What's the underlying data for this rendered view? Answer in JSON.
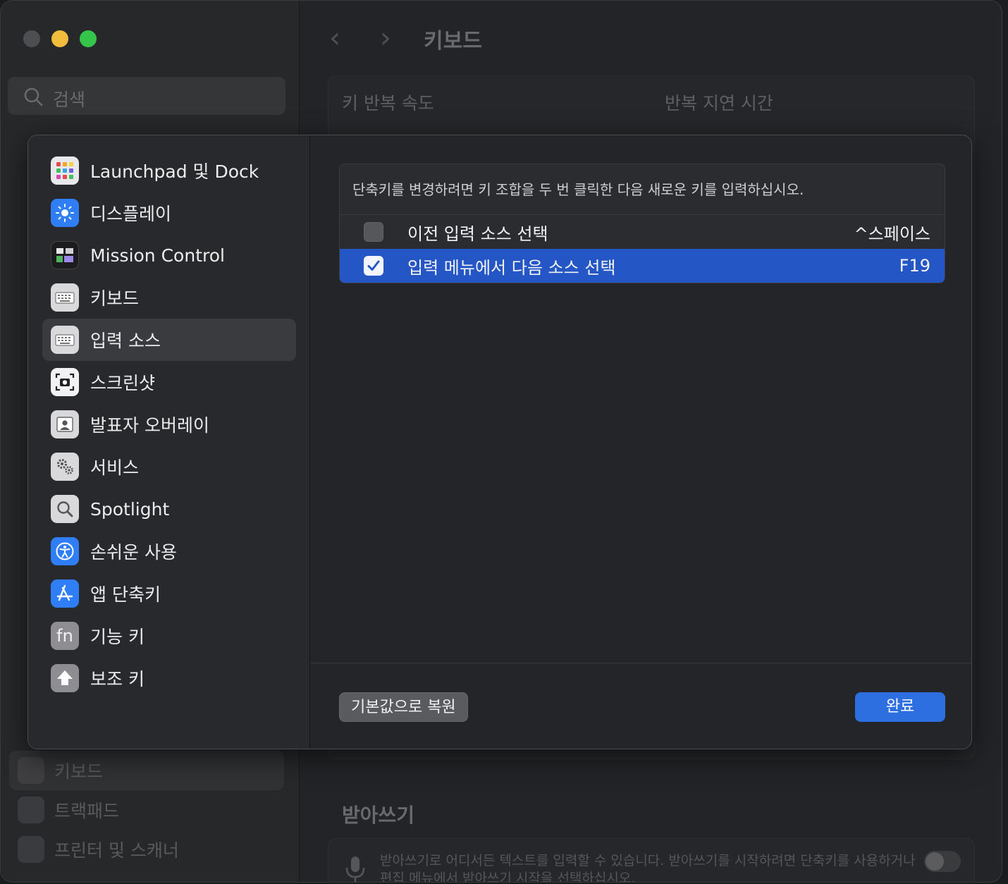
{
  "window": {
    "title": "키보드",
    "search_placeholder": "검색"
  },
  "background_sidebar": [
    {
      "label": "키보드",
      "active": true
    },
    {
      "label": "트랙패드",
      "active": false
    },
    {
      "label": "프린터 및 스캐너",
      "active": false
    }
  ],
  "background_content": {
    "key_repeat_label": "키 반복 속도",
    "repeat_delay_label": "반복 지연 시간",
    "dictation_title": "받아쓰기",
    "dictation_text": "받아쓰기로 어디서든 텍스트를 입력할 수 있습니다. 받아쓰기를 시작하려면 단축키를 사용하거나 편집 메뉴에서 받아쓰기 시작을 선택하십시오."
  },
  "sheet": {
    "categories": [
      {
        "label": "Launchpad 및 Dock",
        "icon": "launchpad-icon",
        "selected": false
      },
      {
        "label": "디스플레이",
        "icon": "display-icon",
        "selected": false
      },
      {
        "label": "Mission Control",
        "icon": "mission-control-icon",
        "selected": false
      },
      {
        "label": "키보드",
        "icon": "keyboard-icon",
        "selected": false
      },
      {
        "label": "입력 소스",
        "icon": "input-source-icon",
        "selected": true
      },
      {
        "label": "스크린샷",
        "icon": "screenshot-icon",
        "selected": false
      },
      {
        "label": "발표자 오버레이",
        "icon": "presenter-overlay-icon",
        "selected": false
      },
      {
        "label": "서비스",
        "icon": "services-icon",
        "selected": false
      },
      {
        "label": "Spotlight",
        "icon": "spotlight-icon",
        "selected": false
      },
      {
        "label": "손쉬운 사용",
        "icon": "accessibility-icon",
        "selected": false
      },
      {
        "label": "앱 단축키",
        "icon": "app-shortcuts-icon",
        "selected": false
      },
      {
        "label": "기능 키",
        "icon": "function-keys-icon",
        "selected": false
      },
      {
        "label": "보조 키",
        "icon": "modifier-keys-icon",
        "selected": false
      }
    ],
    "table_header": "단축키를 변경하려면 키 조합을 두 번 클릭한 다음 새로운 키를 입력하십시오.",
    "rows": [
      {
        "label": "이전 입력 소스 선택",
        "key": "^스페이스",
        "checked": false,
        "selected": false
      },
      {
        "label": "입력 메뉴에서 다음 소스 선택",
        "key": "F19",
        "checked": true,
        "selected": true
      }
    ],
    "restore_button": "기본값으로 복원",
    "done_button": "완료",
    "fn_glyph": "fn"
  },
  "colors": {
    "accent": "#2456c6",
    "done_button": "#2d6ee0"
  }
}
